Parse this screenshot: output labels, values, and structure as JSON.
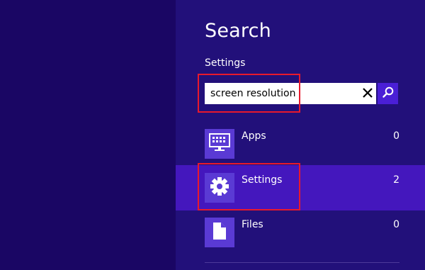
{
  "charm": {
    "title": "Search",
    "scope": "Settings",
    "search": {
      "value": "screen resolution",
      "placeholder": ""
    }
  },
  "results": [
    {
      "label": "Apps",
      "count": "0",
      "icon": "monitor-keyboard-icon",
      "selected": false
    },
    {
      "label": "Settings",
      "count": "2",
      "icon": "gear-icon",
      "selected": true
    },
    {
      "label": "Files",
      "count": "0",
      "icon": "document-icon",
      "selected": false
    }
  ],
  "colors": {
    "panel": "#22107a",
    "background": "#1a0664",
    "selected": "#4417bd",
    "tile": "#5a3ad4",
    "search_button": "#4a1fd6",
    "highlight_box": "#e8192c"
  }
}
